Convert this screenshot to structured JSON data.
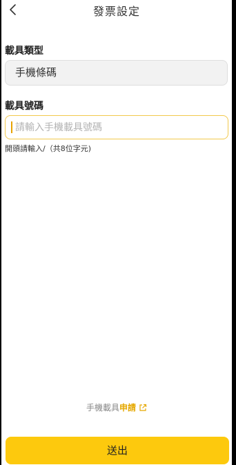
{
  "header": {
    "title": "發票設定",
    "back_icon": "chevron-left-icon"
  },
  "carrier_type": {
    "label": "載具類型",
    "value": "手機條碼"
  },
  "carrier_number": {
    "label": "載具號碼",
    "placeholder": "請輸入手機載具號碼",
    "value": "",
    "hint": "開頭請輸入/（共8位字元)"
  },
  "apply_link": {
    "prefix": "手機載具",
    "accent": "申請",
    "icon": "external-link-icon"
  },
  "submit": {
    "label": "送出"
  },
  "colors": {
    "accent": "#fdc90d",
    "link_accent": "#e5a800",
    "input_border": "#f2c94c"
  }
}
